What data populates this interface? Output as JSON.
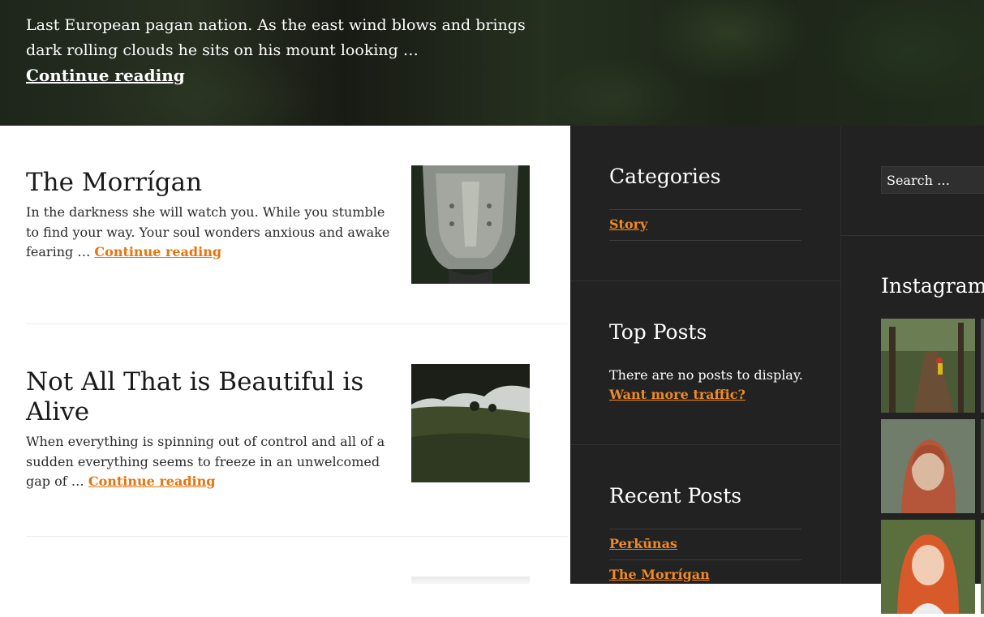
{
  "hero": {
    "excerpt": "Last European pagan nation.  As the east wind blows and brings dark rolling clouds he sits on his mount looking …",
    "link": "Continue reading"
  },
  "posts": [
    {
      "title": "The Morrígan",
      "excerpt": "In the darkness she will watch you. While you stumble to find your way. Your soul wonders anxious and awake fearing … ",
      "link": "Continue reading",
      "thumb_icon": "metal-artifact-image"
    },
    {
      "title": "Not All That is Beautiful is Alive",
      "excerpt": "When everything is spinning out of control and all of a sudden everything seems to freeze in an unwelcomed gap of … ",
      "link": "Continue reading",
      "thumb_icon": "landscape-image"
    }
  ],
  "sidebar": {
    "categories": {
      "title": "Categories",
      "items": [
        "Story"
      ]
    },
    "top_posts": {
      "title": "Top Posts",
      "empty_text": "There are no posts to display.",
      "traffic_link": "Want more traffic?"
    },
    "recent_posts": {
      "title": "Recent Posts",
      "items": [
        "Perkūnas",
        "The Morrígan"
      ]
    },
    "search": {
      "placeholder": "Search …"
    },
    "instagram": {
      "title": "Instagram"
    }
  },
  "colors": {
    "accent": "#e8730c",
    "sidebar_bg": "#222222"
  }
}
